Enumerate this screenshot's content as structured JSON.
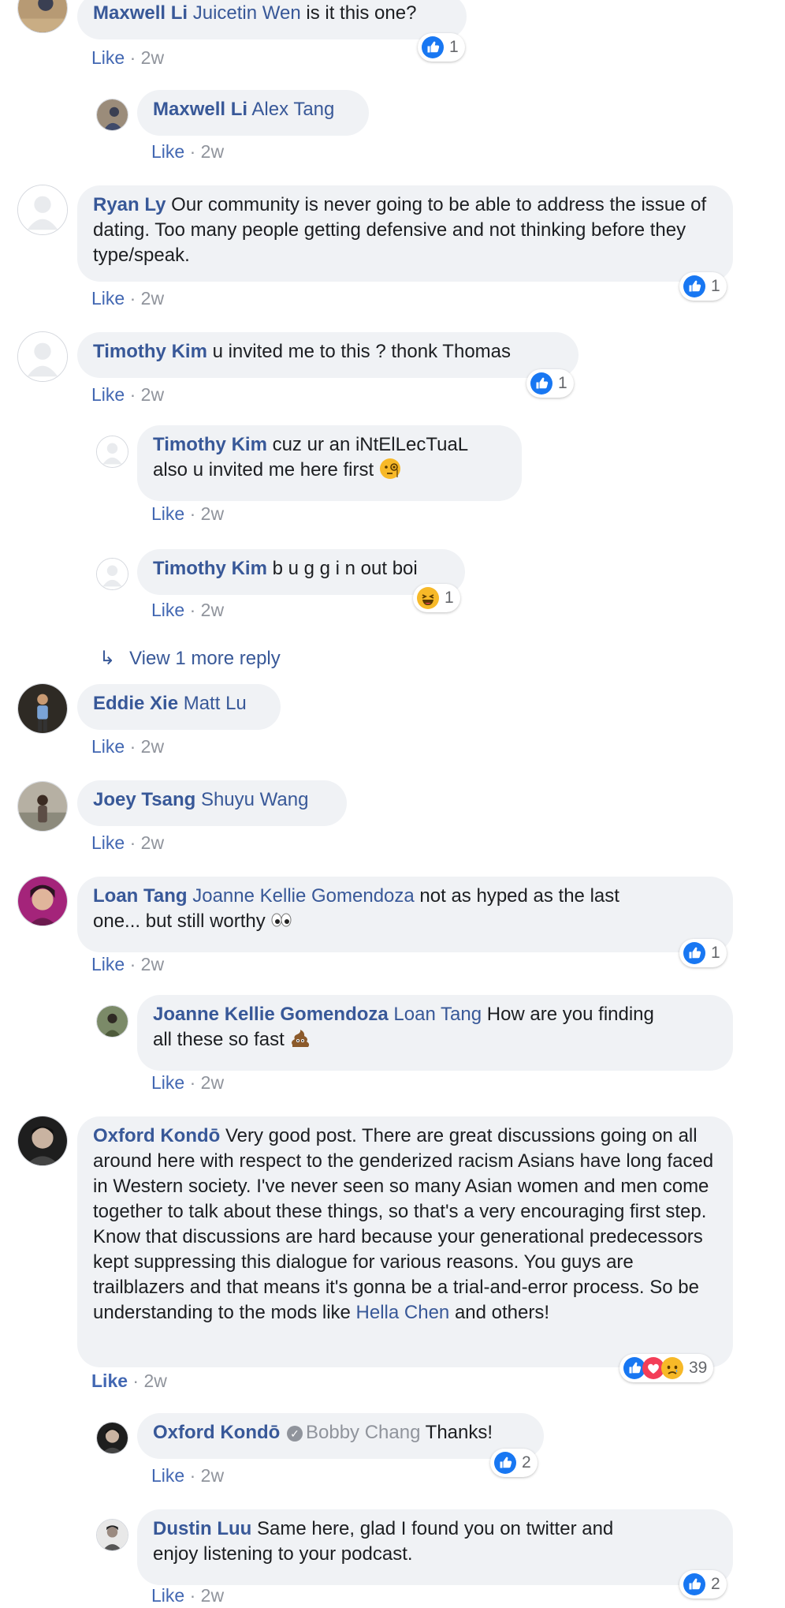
{
  "like_label": "Like",
  "separator": "·",
  "view_more": {
    "arrow": "↳",
    "label": "View 1 more reply"
  },
  "colors": {
    "link": "#385898",
    "like": "#4267b2",
    "meta": "#90949c",
    "bubble": "#f0f2f5",
    "like_blue": "#1877f2",
    "love_red": "#f33e58",
    "sad_yellow": "#f7b928"
  },
  "comments": [
    {
      "author": "Maxwell Li",
      "mention": "Juicetin Wen",
      "text": " is it this one?",
      "time": "2w",
      "reactions": {
        "icons": [
          "like-icon"
        ],
        "count": "1"
      }
    },
    {
      "author": "Maxwell Li",
      "mention": "Alex Tang",
      "text": "",
      "time": "2w"
    },
    {
      "author": "Ryan Ly",
      "text": "Our community is never going to be able to address the issue of dating. Too many people getting defensive and not thinking before they type/speak.",
      "time": "2w",
      "reactions": {
        "icons": [
          "like-icon"
        ],
        "count": "1"
      }
    },
    {
      "author": "Timothy Kim",
      "text": "u invited me to this ? thonk Thomas",
      "time": "2w",
      "reactions": {
        "icons": [
          "like-icon"
        ],
        "count": "1"
      }
    },
    {
      "author": "Timothy Kim",
      "text_line1": "cuz ur an iNtElLecTuaL",
      "text_line2": "also u invited me here first",
      "emoji": "monocle-face-emoji",
      "time": "2w"
    },
    {
      "author": "Timothy Kim",
      "text": "b u g g i n out boi",
      "time": "2w",
      "reactions": {
        "icons": [
          "laughing-icon"
        ],
        "count": "1"
      }
    },
    {
      "author": "Eddie Xie",
      "mention": "Matt Lu",
      "time": "2w"
    },
    {
      "author": "Joey Tsang",
      "mention": "Shuyu Wang",
      "time": "2w"
    },
    {
      "author": "Loan Tang",
      "mention": "Joanne Kellie Gomendoza",
      "text_a": " not as hyped as the last",
      "text_b": "one... but still worthy",
      "emoji": "eyes-emoji",
      "time": "2w",
      "reactions": {
        "icons": [
          "like-icon"
        ],
        "count": "1"
      }
    },
    {
      "author": "Joanne Kellie Gomendoza",
      "mention": "Loan Tang",
      "text_a": " How are you finding",
      "text_b": "all these so fast",
      "emoji": "poop-emoji",
      "time": "2w"
    },
    {
      "author": "Oxford Kondō",
      "text": "Very good post. There are great discussions going on all around here with respect to the genderized racism Asians have long faced in Western society. I've never seen so many Asian women and men come together to talk about these things, so that's a very encouraging first step. Know that discussions are hard because your generational predecessors kept suppressing this dialogue for various reasons. You guys are trailblazers and that means it's gonna be a trial-and-error process. So be understanding to the mods like",
      "mention": "Hella Chen",
      "text_end": " and others!",
      "time": "2w",
      "reactions": {
        "icons": [
          "like-icon",
          "love-icon",
          "sad-icon"
        ],
        "count": "39"
      }
    },
    {
      "author": "Oxford Kondō",
      "verified_glyph": "✓",
      "mention": "Bobby Chang",
      "text": " Thanks!",
      "time": "2w",
      "reactions": {
        "icons": [
          "like-icon"
        ],
        "count": "2"
      }
    },
    {
      "author": "Dustin Luu",
      "text_a": "Same here, glad I found you on twitter and",
      "text_b": "enjoy listening to your podcast.",
      "time": "2w",
      "reactions": {
        "icons": [
          "like-icon"
        ],
        "count": "2"
      }
    }
  ]
}
